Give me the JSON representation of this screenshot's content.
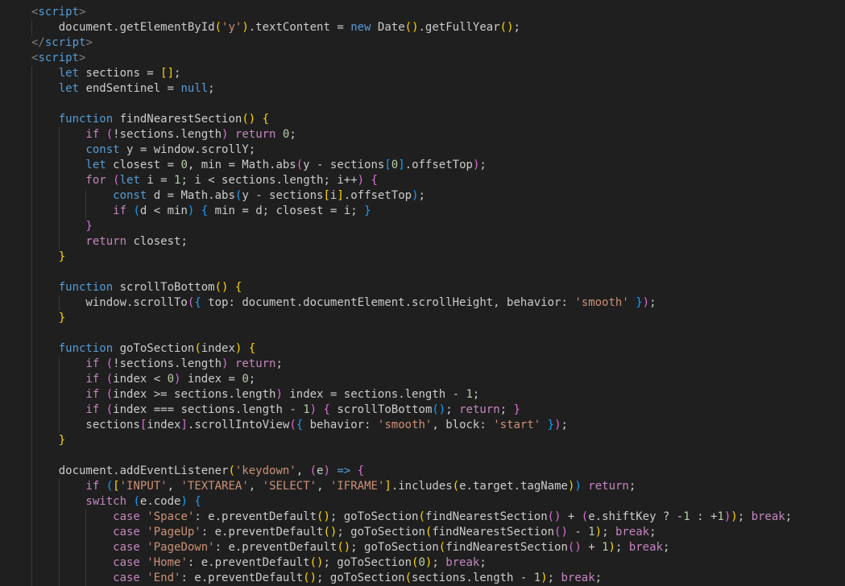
{
  "editor": {
    "language": "html",
    "theme_colors": {
      "background": "#1f1f1f",
      "text": "#cccccc",
      "keyword": "#569cd6",
      "control": "#c586c0",
      "function": "#dcdcaa",
      "string": "#ce9178",
      "number": "#b5cea8",
      "bracket_level_1": "#ffd700",
      "bracket_level_2": "#da70d6",
      "bracket_level_3": "#179fff"
    },
    "lines": [
      [
        [
          "tag",
          "<"
        ],
        [
          "tagname",
          "script"
        ],
        [
          "tag",
          ">"
        ]
      ],
      [
        [
          "plain",
          "    document.getElementById"
        ],
        [
          "p1",
          "("
        ],
        [
          "str",
          "'y'"
        ],
        [
          "p1",
          ")"
        ],
        [
          "plain",
          ".textContent = "
        ],
        [
          "kw",
          "new"
        ],
        [
          "plain",
          " Date"
        ],
        [
          "p1",
          "()"
        ],
        [
          "plain",
          ".getFullYear"
        ],
        [
          "p1",
          "()"
        ],
        [
          "plain",
          ";"
        ]
      ],
      [
        [
          "tag",
          "</"
        ],
        [
          "tagname",
          "script"
        ],
        [
          "tag",
          ">"
        ]
      ],
      [
        [
          "tag",
          "<"
        ],
        [
          "tagname",
          "script"
        ],
        [
          "tag",
          ">"
        ]
      ],
      [
        [
          "kw",
          "    let"
        ],
        [
          "plain",
          " sections = "
        ],
        [
          "p1",
          "[]"
        ],
        [
          "plain",
          ";"
        ]
      ],
      [
        [
          "kw",
          "    let"
        ],
        [
          "plain",
          " endSentinel = "
        ],
        [
          "kw",
          "null"
        ],
        [
          "plain",
          ";"
        ]
      ],
      [],
      [
        [
          "kw",
          "    function"
        ],
        [
          "plain",
          " findNearestSection"
        ],
        [
          "p1",
          "()"
        ],
        [
          "plain",
          " "
        ],
        [
          "p1",
          "{"
        ]
      ],
      [
        [
          "ctl",
          "        if"
        ],
        [
          "plain",
          " "
        ],
        [
          "p2",
          "("
        ],
        [
          "plain",
          "!sections.length"
        ],
        [
          "p2",
          ")"
        ],
        [
          "plain",
          " "
        ],
        [
          "ctl",
          "return"
        ],
        [
          "plain",
          " "
        ],
        [
          "num",
          "0"
        ],
        [
          "plain",
          ";"
        ]
      ],
      [
        [
          "kw",
          "        const"
        ],
        [
          "plain",
          " y = window.scrollY;"
        ]
      ],
      [
        [
          "kw",
          "        let"
        ],
        [
          "plain",
          " closest = "
        ],
        [
          "num",
          "0"
        ],
        [
          "plain",
          ", min = Math.abs"
        ],
        [
          "p2",
          "("
        ],
        [
          "plain",
          "y - sections"
        ],
        [
          "p3",
          "["
        ],
        [
          "num",
          "0"
        ],
        [
          "p3",
          "]"
        ],
        [
          "plain",
          ".offsetTop"
        ],
        [
          "p2",
          ")"
        ],
        [
          "plain",
          ";"
        ]
      ],
      [
        [
          "ctl",
          "        for"
        ],
        [
          "plain",
          " "
        ],
        [
          "p2",
          "("
        ],
        [
          "kw",
          "let"
        ],
        [
          "plain",
          " i = "
        ],
        [
          "num",
          "1"
        ],
        [
          "plain",
          "; i < sections.length; i++"
        ],
        [
          "p2",
          ")"
        ],
        [
          "plain",
          " "
        ],
        [
          "p2",
          "{"
        ]
      ],
      [
        [
          "kw",
          "            const"
        ],
        [
          "plain",
          " d = Math.abs"
        ],
        [
          "p3",
          "("
        ],
        [
          "plain",
          "y - sections"
        ],
        [
          "p1",
          "["
        ],
        [
          "plain",
          "i"
        ],
        [
          "p1",
          "]"
        ],
        [
          "plain",
          ".offsetTop"
        ],
        [
          "p3",
          ")"
        ],
        [
          "plain",
          ";"
        ]
      ],
      [
        [
          "ctl",
          "            if"
        ],
        [
          "plain",
          " "
        ],
        [
          "p3",
          "("
        ],
        [
          "plain",
          "d < min"
        ],
        [
          "p3",
          ")"
        ],
        [
          "plain",
          " "
        ],
        [
          "p3",
          "{"
        ],
        [
          "plain",
          " min = d; closest = i; "
        ],
        [
          "p3",
          "}"
        ]
      ],
      [
        [
          "p2",
          "        }"
        ]
      ],
      [
        [
          "ctl",
          "        return"
        ],
        [
          "plain",
          " closest;"
        ]
      ],
      [
        [
          "p1",
          "    }"
        ]
      ],
      [],
      [
        [
          "kw",
          "    function"
        ],
        [
          "plain",
          " scrollToBottom"
        ],
        [
          "p1",
          "()"
        ],
        [
          "plain",
          " "
        ],
        [
          "p1",
          "{"
        ]
      ],
      [
        [
          "plain",
          "        window.scrollTo"
        ],
        [
          "p2",
          "("
        ],
        [
          "p3",
          "{"
        ],
        [
          "plain",
          " top: document.documentElement.scrollHeight, behavior: "
        ],
        [
          "str",
          "'smooth'"
        ],
        [
          "plain",
          " "
        ],
        [
          "p3",
          "}"
        ],
        [
          "p2",
          ")"
        ],
        [
          "plain",
          ";"
        ]
      ],
      [
        [
          "p1",
          "    }"
        ]
      ],
      [],
      [
        [
          "kw",
          "    function"
        ],
        [
          "plain",
          " goToSection"
        ],
        [
          "p1",
          "("
        ],
        [
          "plain",
          "index"
        ],
        [
          "p1",
          ")"
        ],
        [
          "plain",
          " "
        ],
        [
          "p1",
          "{"
        ]
      ],
      [
        [
          "ctl",
          "        if"
        ],
        [
          "plain",
          " "
        ],
        [
          "p2",
          "("
        ],
        [
          "plain",
          "!sections.length"
        ],
        [
          "p2",
          ")"
        ],
        [
          "plain",
          " "
        ],
        [
          "ctl",
          "return"
        ],
        [
          "plain",
          ";"
        ]
      ],
      [
        [
          "ctl",
          "        if"
        ],
        [
          "plain",
          " "
        ],
        [
          "p2",
          "("
        ],
        [
          "plain",
          "index < "
        ],
        [
          "num",
          "0"
        ],
        [
          "p2",
          ")"
        ],
        [
          "plain",
          " index = "
        ],
        [
          "num",
          "0"
        ],
        [
          "plain",
          ";"
        ]
      ],
      [
        [
          "ctl",
          "        if"
        ],
        [
          "plain",
          " "
        ],
        [
          "p2",
          "("
        ],
        [
          "plain",
          "index >= sections.length"
        ],
        [
          "p2",
          ")"
        ],
        [
          "plain",
          " index = sections.length - "
        ],
        [
          "num",
          "1"
        ],
        [
          "plain",
          ";"
        ]
      ],
      [
        [
          "ctl",
          "        if"
        ],
        [
          "plain",
          " "
        ],
        [
          "p2",
          "("
        ],
        [
          "plain",
          "index === sections.length - "
        ],
        [
          "num",
          "1"
        ],
        [
          "p2",
          ")"
        ],
        [
          "plain",
          " "
        ],
        [
          "p2",
          "{"
        ],
        [
          "plain",
          " scrollToBottom"
        ],
        [
          "p3",
          "()"
        ],
        [
          "plain",
          "; "
        ],
        [
          "ctl",
          "return"
        ],
        [
          "plain",
          "; "
        ],
        [
          "p2",
          "}"
        ]
      ],
      [
        [
          "plain",
          "        sections"
        ],
        [
          "p2",
          "["
        ],
        [
          "plain",
          "index"
        ],
        [
          "p2",
          "]"
        ],
        [
          "plain",
          ".scrollIntoView"
        ],
        [
          "p2",
          "("
        ],
        [
          "p3",
          "{"
        ],
        [
          "plain",
          " behavior: "
        ],
        [
          "str",
          "'smooth'"
        ],
        [
          "plain",
          ", block: "
        ],
        [
          "str",
          "'start'"
        ],
        [
          "plain",
          " "
        ],
        [
          "p3",
          "}"
        ],
        [
          "p2",
          ")"
        ],
        [
          "plain",
          ";"
        ]
      ],
      [
        [
          "p1",
          "    }"
        ]
      ],
      [],
      [
        [
          "plain",
          "    document.addEventListener"
        ],
        [
          "p1",
          "("
        ],
        [
          "str",
          "'keydown'"
        ],
        [
          "plain",
          ", "
        ],
        [
          "p2",
          "("
        ],
        [
          "plain",
          "e"
        ],
        [
          "p2",
          ")"
        ],
        [
          "plain",
          " "
        ],
        [
          "kw",
          "=>"
        ],
        [
          "plain",
          " "
        ],
        [
          "p2",
          "{"
        ]
      ],
      [
        [
          "ctl",
          "        if"
        ],
        [
          "plain",
          " "
        ],
        [
          "p3",
          "("
        ],
        [
          "p1",
          "["
        ],
        [
          "str",
          "'INPUT'"
        ],
        [
          "plain",
          ", "
        ],
        [
          "str",
          "'TEXTAREA'"
        ],
        [
          "plain",
          ", "
        ],
        [
          "str",
          "'SELECT'"
        ],
        [
          "plain",
          ", "
        ],
        [
          "str",
          "'IFRAME'"
        ],
        [
          "p1",
          "]"
        ],
        [
          "plain",
          ".includes"
        ],
        [
          "p1",
          "("
        ],
        [
          "plain",
          "e.target.tagName"
        ],
        [
          "p1",
          ")"
        ],
        [
          "p3",
          ")"
        ],
        [
          "plain",
          " "
        ],
        [
          "ctl",
          "return"
        ],
        [
          "plain",
          ";"
        ]
      ],
      [
        [
          "ctl",
          "        switch"
        ],
        [
          "plain",
          " "
        ],
        [
          "p3",
          "("
        ],
        [
          "plain",
          "e.code"
        ],
        [
          "p3",
          ")"
        ],
        [
          "plain",
          " "
        ],
        [
          "p3",
          "{"
        ]
      ],
      [
        [
          "ctl",
          "            case"
        ],
        [
          "plain",
          " "
        ],
        [
          "str",
          "'Space'"
        ],
        [
          "plain",
          ": e.preventDefault"
        ],
        [
          "p1",
          "()"
        ],
        [
          "plain",
          "; goToSection"
        ],
        [
          "p1",
          "("
        ],
        [
          "plain",
          "findNearestSection"
        ],
        [
          "p2",
          "()"
        ],
        [
          "plain",
          " + "
        ],
        [
          "p2",
          "("
        ],
        [
          "plain",
          "e.shiftKey ? -"
        ],
        [
          "num",
          "1"
        ],
        [
          "plain",
          " : +"
        ],
        [
          "num",
          "1"
        ],
        [
          "p2",
          ")"
        ],
        [
          "p1",
          ")"
        ],
        [
          "plain",
          "; "
        ],
        [
          "ctl",
          "break"
        ],
        [
          "plain",
          ";"
        ]
      ],
      [
        [
          "ctl",
          "            case"
        ],
        [
          "plain",
          " "
        ],
        [
          "str",
          "'PageUp'"
        ],
        [
          "plain",
          ": e.preventDefault"
        ],
        [
          "p1",
          "()"
        ],
        [
          "plain",
          "; goToSection"
        ],
        [
          "p1",
          "("
        ],
        [
          "plain",
          "findNearestSection"
        ],
        [
          "p2",
          "()"
        ],
        [
          "plain",
          " - "
        ],
        [
          "num",
          "1"
        ],
        [
          "p1",
          ")"
        ],
        [
          "plain",
          "; "
        ],
        [
          "ctl",
          "break"
        ],
        [
          "plain",
          ";"
        ]
      ],
      [
        [
          "ctl",
          "            case"
        ],
        [
          "plain",
          " "
        ],
        [
          "str",
          "'PageDown'"
        ],
        [
          "plain",
          ": e.preventDefault"
        ],
        [
          "p1",
          "()"
        ],
        [
          "plain",
          "; goToSection"
        ],
        [
          "p1",
          "("
        ],
        [
          "plain",
          "findNearestSection"
        ],
        [
          "p2",
          "()"
        ],
        [
          "plain",
          " + "
        ],
        [
          "num",
          "1"
        ],
        [
          "p1",
          ")"
        ],
        [
          "plain",
          "; "
        ],
        [
          "ctl",
          "break"
        ],
        [
          "plain",
          ";"
        ]
      ],
      [
        [
          "ctl",
          "            case"
        ],
        [
          "plain",
          " "
        ],
        [
          "str",
          "'Home'"
        ],
        [
          "plain",
          ": e.preventDefault"
        ],
        [
          "p1",
          "()"
        ],
        [
          "plain",
          "; goToSection"
        ],
        [
          "p1",
          "("
        ],
        [
          "num",
          "0"
        ],
        [
          "p1",
          ")"
        ],
        [
          "plain",
          "; "
        ],
        [
          "ctl",
          "break"
        ],
        [
          "plain",
          ";"
        ]
      ],
      [
        [
          "ctl",
          "            case"
        ],
        [
          "plain",
          " "
        ],
        [
          "str",
          "'End'"
        ],
        [
          "plain",
          ": e.preventDefault"
        ],
        [
          "p1",
          "()"
        ],
        [
          "plain",
          "; goToSection"
        ],
        [
          "p1",
          "("
        ],
        [
          "plain",
          "sections.length - "
        ],
        [
          "num",
          "1"
        ],
        [
          "p1",
          ")"
        ],
        [
          "plain",
          "; "
        ],
        [
          "ctl",
          "break"
        ],
        [
          "plain",
          ";"
        ]
      ]
    ]
  }
}
